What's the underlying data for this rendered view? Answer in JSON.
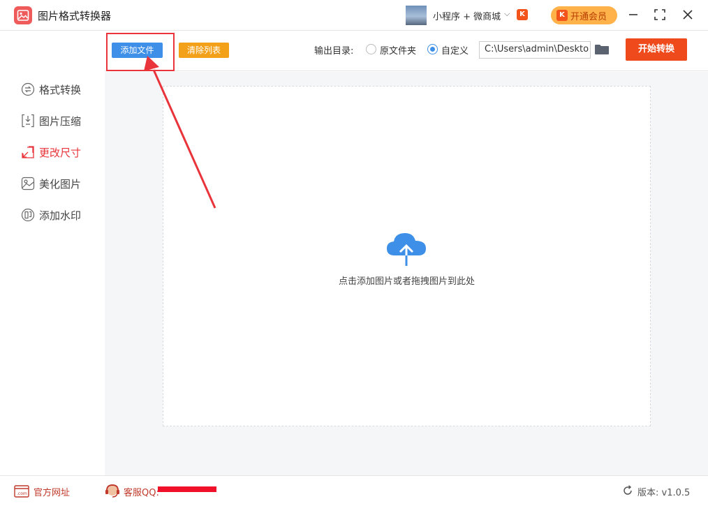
{
  "app": {
    "title": "图片格式转换器"
  },
  "titlebar": {
    "miniprogram_label": "小程序 + 微商城",
    "badge_letter": "K",
    "vip_label": "开通会员"
  },
  "toolbar": {
    "add_file": "添加文件",
    "clear_list": "清除列表",
    "output_dir_label": "输出目录:",
    "option_source": "原文件夹",
    "option_custom": "自定义",
    "selected_option": "自定义",
    "output_path": "C:\\Users\\admin\\Deskto",
    "start": "开始转换"
  },
  "sidebar": {
    "items": [
      {
        "label": "格式转换",
        "icon": "swap-icon",
        "active": false
      },
      {
        "label": "图片压缩",
        "icon": "compress-icon",
        "active": false
      },
      {
        "label": "更改尺寸",
        "icon": "resize-icon",
        "active": true
      },
      {
        "label": "美化图片",
        "icon": "beautify-icon",
        "active": false
      },
      {
        "label": "添加水印",
        "icon": "watermark-icon",
        "active": false
      }
    ]
  },
  "main": {
    "drop_hint": "点击添加图片或者拖拽图片到此处",
    "upload_icon": "cloud-upload-icon"
  },
  "footer": {
    "website": "官方网址",
    "support": "客服QQ:",
    "version": "版本: v1.0.5"
  },
  "colors": {
    "accent_blue": "#3d8fe8",
    "accent_red": "#e8343a",
    "start_orange": "#ef4a1c",
    "clear_orange": "#f4a11a",
    "vip_gold": "#ffb24a"
  }
}
